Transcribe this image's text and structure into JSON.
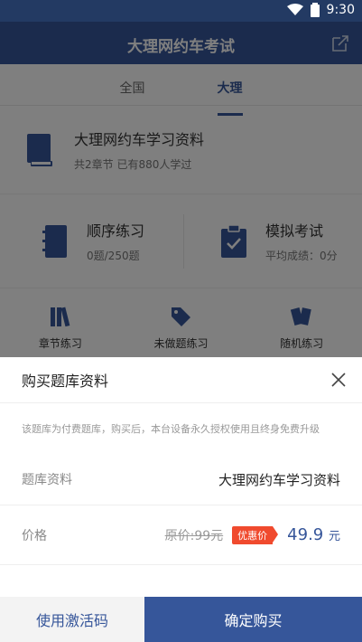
{
  "status": {
    "time": "9:30"
  },
  "appbar": {
    "title": "大理网约车考试"
  },
  "tabs": [
    {
      "label": "全国"
    },
    {
      "label": "大理"
    }
  ],
  "study": {
    "title": "大理网约车学习资料",
    "subtitle": "共2章节  已有880人学过"
  },
  "practice": [
    {
      "title": "顺序练习",
      "subtitle": "0题/250题"
    },
    {
      "title": "模拟考试",
      "subtitle": "平均成绩：0分"
    }
  ],
  "quick": [
    {
      "label": "章节练习"
    },
    {
      "label": "未做题练习"
    },
    {
      "label": "随机练习"
    }
  ],
  "sheet": {
    "title": "购买题库资料",
    "note": "该题库为付费题库，购买后，本台设备永久授权使用且终身免费升级",
    "material_label": "题库资料",
    "material_value": "大理网约车学习资料",
    "price_label": "价格",
    "original_price": "原价:99元",
    "badge": "优惠价",
    "sale_price": "49.9",
    "sale_unit": "元"
  },
  "actions": {
    "activate": "使用激活码",
    "confirm": "确定购买"
  },
  "colors": {
    "primary": "#36569a",
    "badge": "#f04a2e"
  }
}
